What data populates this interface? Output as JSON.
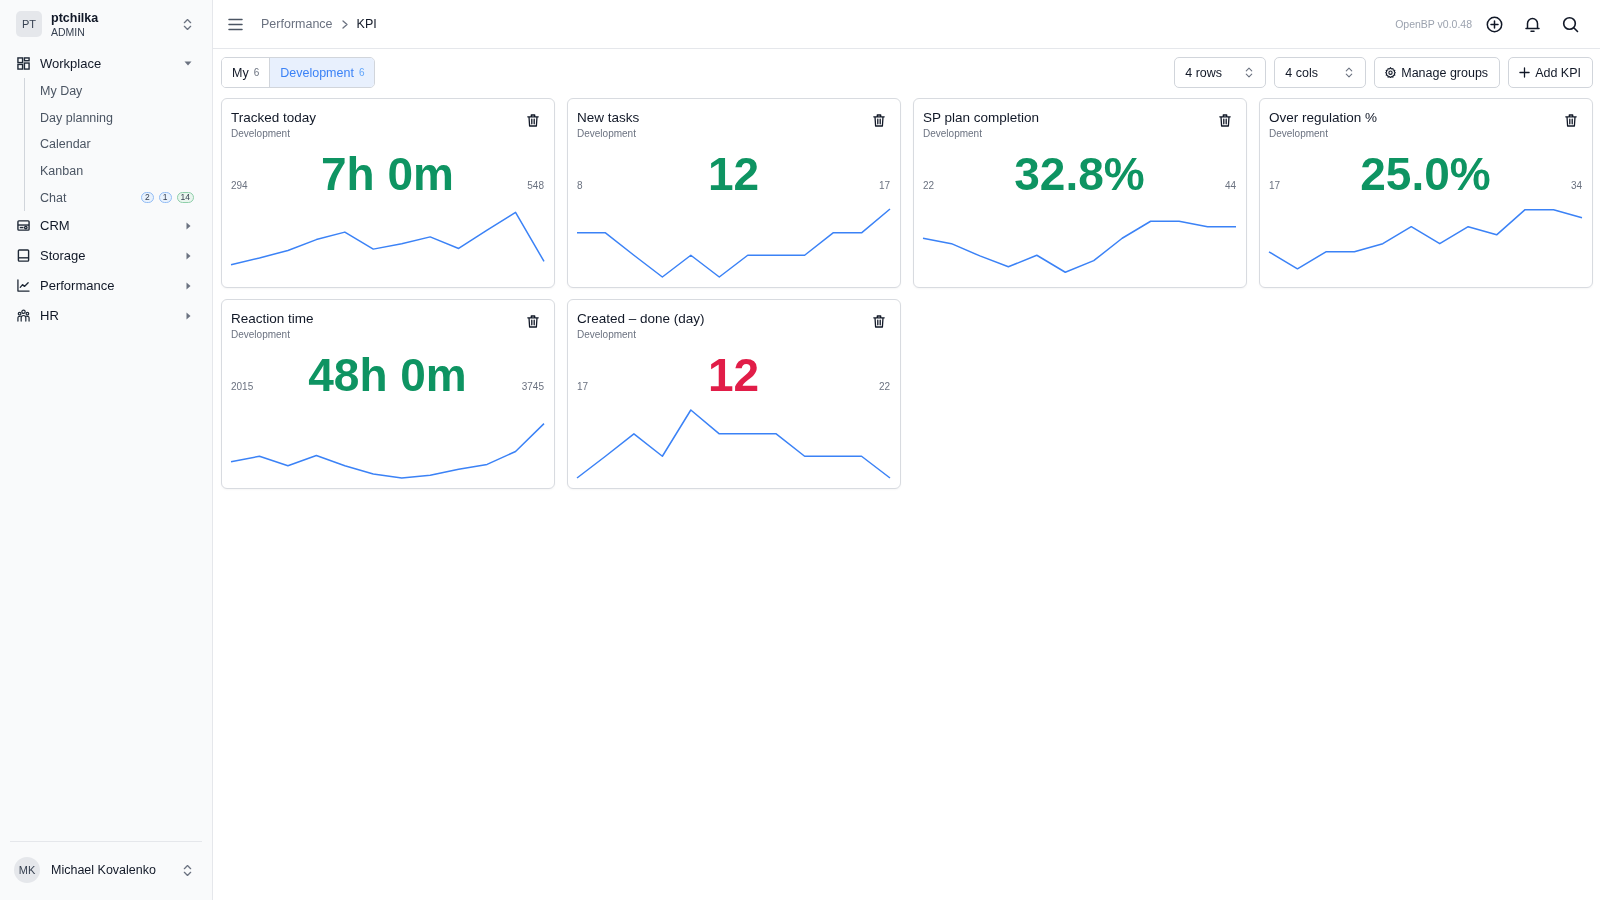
{
  "sidebar": {
    "user": {
      "initials": "PT",
      "name": "ptchilka",
      "role": "ADMIN"
    },
    "nav": [
      {
        "label": "Workplace",
        "expanded": true,
        "children": [
          {
            "label": "My Day"
          },
          {
            "label": "Day planning"
          },
          {
            "label": "Calendar"
          },
          {
            "label": "Kanban"
          },
          {
            "label": "Chat",
            "badges": [
              {
                "text": "2",
                "color": "#93bdf5"
              },
              {
                "text": "1",
                "color": "#93bdf5"
              },
              {
                "text": "14",
                "color": "#8fcfaa"
              }
            ]
          }
        ]
      },
      {
        "label": "CRM",
        "expanded": false
      },
      {
        "label": "Storage",
        "expanded": false
      },
      {
        "label": "Performance",
        "expanded": false
      },
      {
        "label": "HR",
        "expanded": false
      }
    ],
    "footer_user": {
      "initials": "MK",
      "name": "Michael Kovalenko"
    }
  },
  "topbar": {
    "breadcrumb": [
      "Performance",
      "KPI"
    ],
    "version": "OpenBP v0.0.48"
  },
  "toolbar": {
    "tabs": [
      {
        "label": "My",
        "count": "6",
        "selected": false
      },
      {
        "label": "Development",
        "count": "6",
        "selected": true
      }
    ],
    "selects": [
      "4 rows",
      "4 cols"
    ],
    "buttons": [
      "Manage groups",
      "Add KPI"
    ]
  },
  "kpis": [
    {
      "title": "Tracked today",
      "group": "Development",
      "value": "7h 0m",
      "min": "294",
      "max": "548",
      "color": "#0e9462"
    },
    {
      "title": "New tasks",
      "group": "Development",
      "value": "12",
      "min": "8",
      "max": "17",
      "color": "#0e9462"
    },
    {
      "title": "SP plan completion",
      "group": "Development",
      "value": "32.8%",
      "min": "22",
      "max": "44",
      "color": "#0e9462"
    },
    {
      "title": "Over regulation %",
      "group": "Development",
      "value": "25.0%",
      "min": "17",
      "max": "34",
      "color": "#0e9462"
    },
    {
      "title": "Reaction time",
      "group": "Development",
      "value": "48h 0m",
      "min": "2015",
      "max": "3745",
      "color": "#0e9462"
    },
    {
      "title": "Created – done (day)",
      "group": "Development",
      "value": "12",
      "min": "17",
      "max": "22",
      "color": "#e11d48"
    }
  ]
}
